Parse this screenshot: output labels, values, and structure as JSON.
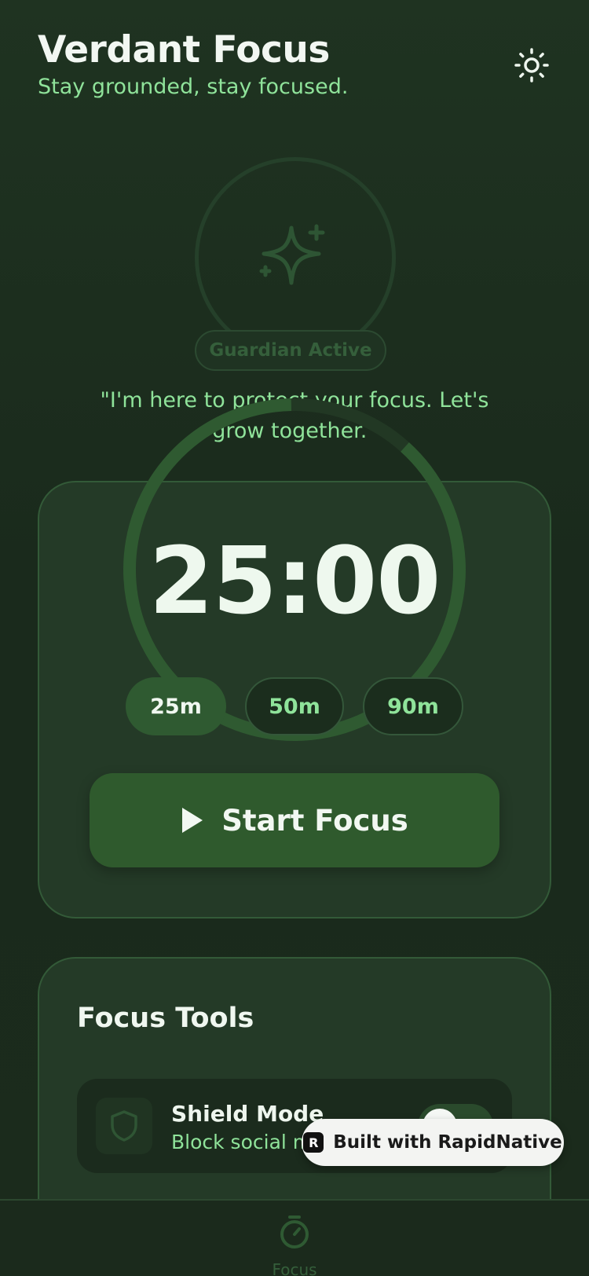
{
  "app": {
    "title": "Verdant Focus",
    "subtitle": "Stay grounded, stay focused."
  },
  "header": {
    "theme_icon": "sun-icon"
  },
  "guardian": {
    "icon": "sparkle-icon",
    "badge": "Guardian Active",
    "quote": "\"I'm here to protect your focus. Let's grow together.\""
  },
  "timer": {
    "time": "25:00",
    "progress_fraction": 0.88,
    "presets": [
      {
        "label": "25m",
        "selected": true
      },
      {
        "label": "50m",
        "selected": false
      },
      {
        "label": "90m",
        "selected": false
      }
    ],
    "start_label": "Start Focus",
    "start_icon": "play-icon"
  },
  "tools": {
    "title": "Focus Tools",
    "items": [
      {
        "name": "Shield Mode",
        "description": "Block social me",
        "icon": "shield-icon",
        "toggle_on": false
      }
    ]
  },
  "badge": {
    "label": "Built with RapidNative",
    "logo": "R"
  },
  "tabbar": {
    "items": [
      {
        "label": "Focus",
        "icon": "timer-icon"
      }
    ]
  },
  "colors": {
    "background": "#1c2a1d",
    "accent": "#8fe39a",
    "card": "#243a27",
    "primary_button": "#2f5a2d"
  }
}
